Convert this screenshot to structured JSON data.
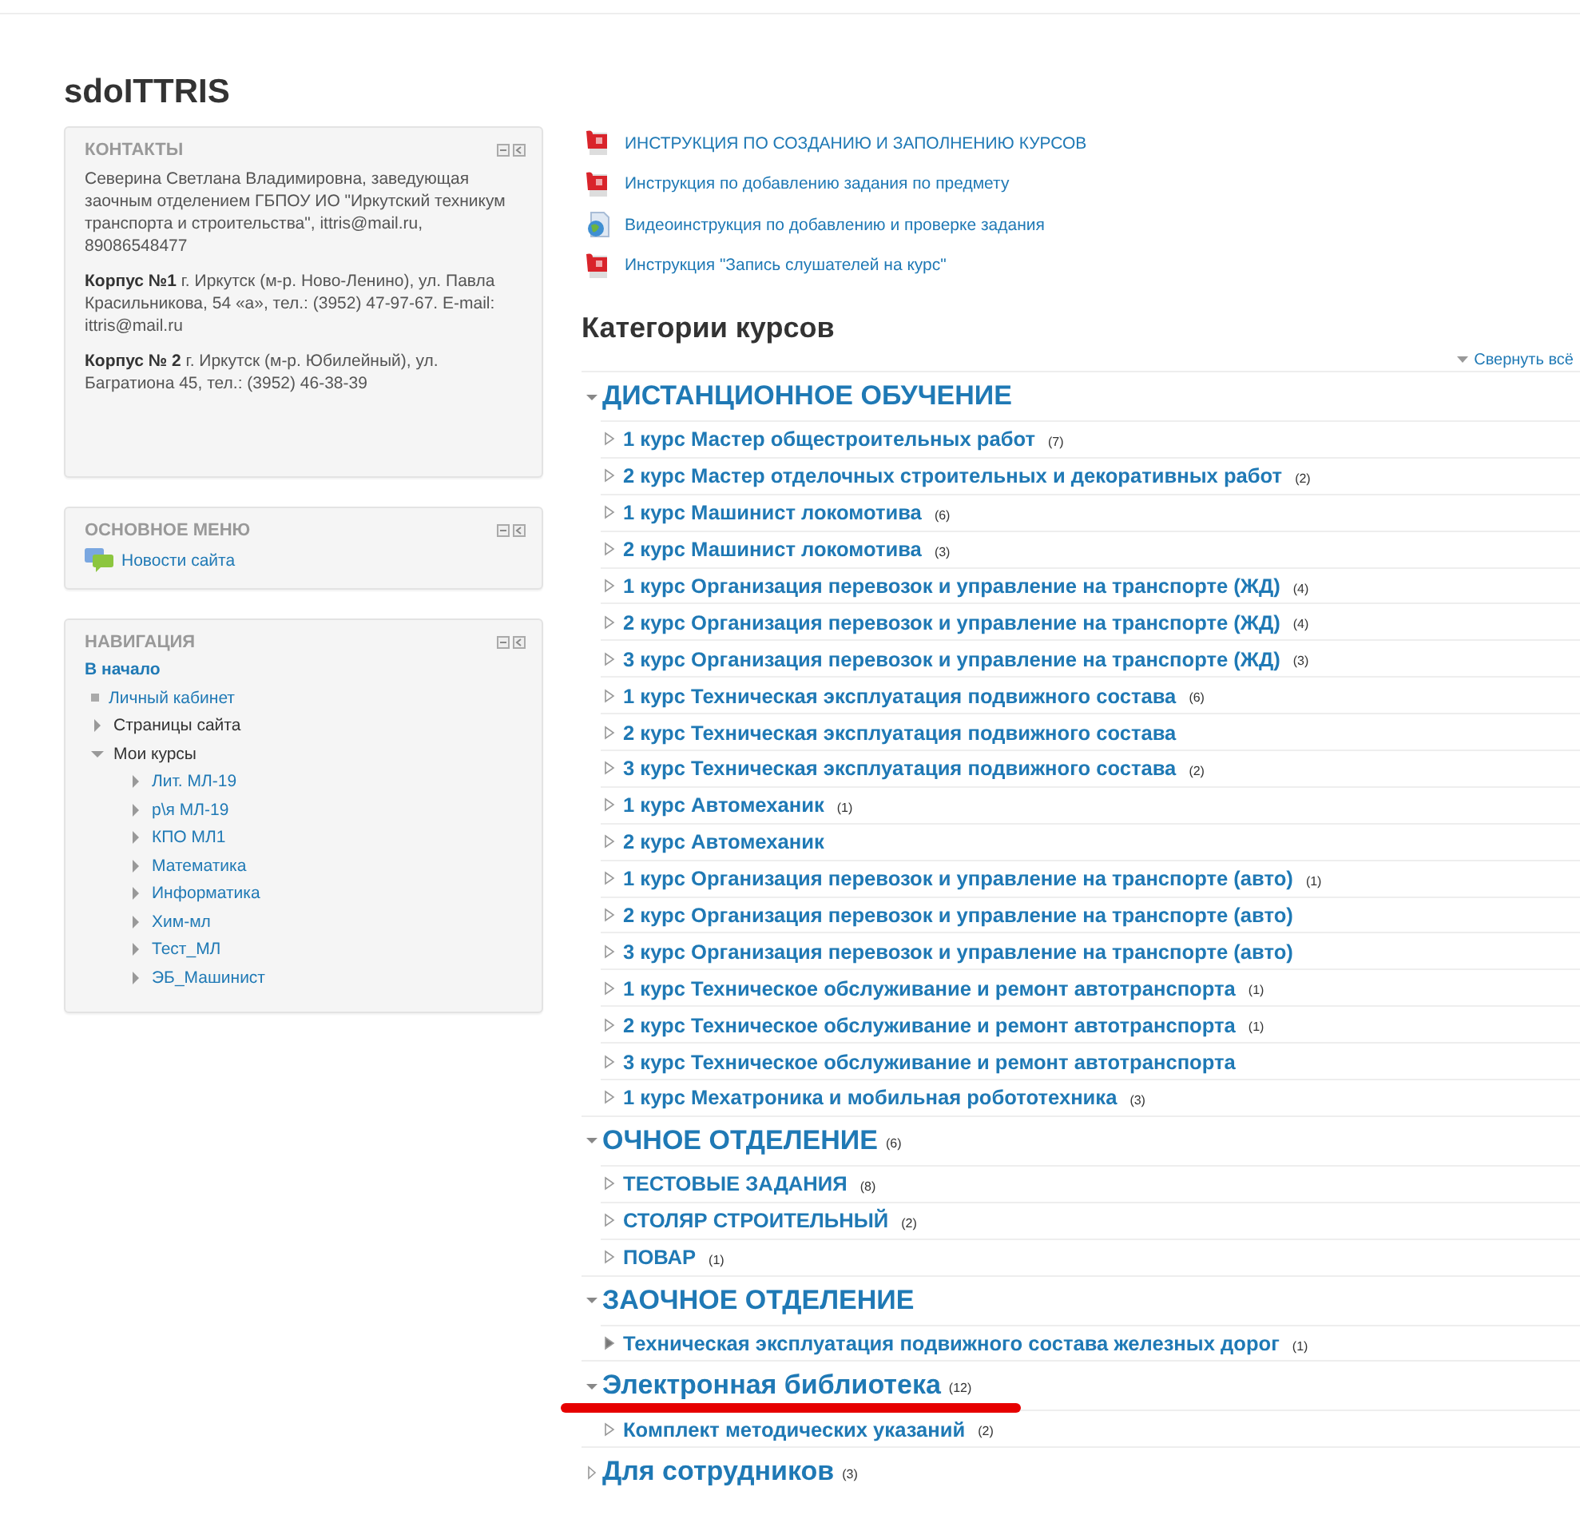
{
  "site_title": "sdoITTRIS",
  "contacts": {
    "title": "КОНТАКТЫ",
    "paragraphs": [
      "Северина Светлана Владимировна, заведующая заочным отделением ГБПОУ ИО \"Иркутский техникум транспорта и строительства\", ittris@mail.ru, 89086548477",
      "**Корпус №1** г. Иркутск (м-р. Ново-Ленино), ул. Павла Красильникова, 54 «а», тел.: (3952) 47-97-67. E-mail: ittris@mail.ru",
      "**Корпус № 2** г. Иркутск (м-р. Юбилейный), ул. Багратиона 45, тел.: (3952) 46-38-39"
    ]
  },
  "main_menu": {
    "title": "ОСНОВНОЕ МЕНЮ",
    "items": [
      "Новости сайта"
    ]
  },
  "navigation": {
    "title": "НАВИГАЦИЯ",
    "home": "В начало",
    "items": [
      {
        "label": "Личный кабинет",
        "kind": "leaf",
        "link": true
      },
      {
        "label": "Страницы сайта",
        "kind": "branch",
        "link": false,
        "expanded": false
      },
      {
        "label": "Мои курсы",
        "kind": "branch",
        "link": false,
        "expanded": true,
        "children": [
          {
            "label": "Лит. МЛ-19",
            "kind": "branch",
            "link": true,
            "expanded": false
          },
          {
            "label": "р\\я МЛ-19",
            "kind": "branch",
            "link": true,
            "expanded": false
          },
          {
            "label": "КПО МЛ1",
            "kind": "branch",
            "link": true,
            "expanded": false
          },
          {
            "label": "Математика",
            "kind": "branch",
            "link": true,
            "expanded": false
          },
          {
            "label": "Информатика",
            "kind": "branch",
            "link": true,
            "expanded": false
          },
          {
            "label": "Хим-мл",
            "kind": "branch",
            "link": true,
            "expanded": false
          },
          {
            "label": "Тест_МЛ",
            "kind": "branch",
            "link": true,
            "expanded": false
          },
          {
            "label": "ЭБ_Машинист",
            "kind": "branch",
            "link": true,
            "expanded": false
          }
        ]
      }
    ]
  },
  "resources": [
    {
      "label": "ИНСТРУКЦИЯ ПО СОЗДАНИЮ И ЗАПОЛНЕНИЮ КУРСОВ",
      "kind": "pdf"
    },
    {
      "label": "Инструкция по добавлению задания по предмету",
      "kind": "pdf"
    },
    {
      "label": "Видеоинструкция по добавлению и проверке задания",
      "kind": "web"
    },
    {
      "label": "Инструкция \"Запись слушателей на курс\"",
      "kind": "pdf"
    }
  ],
  "categories_heading": "Категории курсов",
  "collapse_all": "Свернуть всё",
  "categories": [
    {
      "name": "ДИСТАНЦИОННОЕ ОБУЧЕНИЕ",
      "expanded": true,
      "marked": false,
      "children": [
        {
          "name": "1 курс Мастер общестроительных работ",
          "count": "(7)",
          "kind": "hollow"
        },
        {
          "name": "2 курс Мастер отделочных строительных и декоративных работ",
          "count": "(2)",
          "kind": "hollow"
        },
        {
          "name": "1 курс Машинист локомотива",
          "count": "(6)",
          "kind": "hollow"
        },
        {
          "name": "2 курс Машинист локомотива",
          "count": "(3)",
          "kind": "hollow"
        },
        {
          "name": "1 курс Организация перевозок и управление на транспорте (ЖД)",
          "count": "(4)",
          "kind": "hollow"
        },
        {
          "name": "2 курс Организация перевозок и управление на транспорте (ЖД)",
          "count": "(4)",
          "kind": "hollow"
        },
        {
          "name": "3 курс Организация перевозок и управление на транспорте (ЖД)",
          "count": "(3)",
          "kind": "hollow"
        },
        {
          "name": "1 курс Техническая эксплуатация подвижного состава",
          "count": "(6)",
          "kind": "hollow"
        },
        {
          "name": "2 курс Техническая эксплуатация подвижного состава",
          "kind": "hollow"
        },
        {
          "name": "3 курс Техническая эксплуатация подвижного состава",
          "count": "(2)",
          "kind": "hollow"
        },
        {
          "name": "1 курс Автомеханик",
          "count": "(1)",
          "kind": "hollow"
        },
        {
          "name": "2 курс Автомеханик",
          "kind": "hollow"
        },
        {
          "name": "1 курс Организация перевозок и управление на транспорте (авто)",
          "count": "(1)",
          "kind": "hollow"
        },
        {
          "name": "2 курс Организация перевозок и управление на транспорте (авто)",
          "kind": "hollow"
        },
        {
          "name": "3 курс Организация перевозок и управление на транспорте (авто)",
          "kind": "hollow"
        },
        {
          "name": "1 курс Техническое обслуживание и ремонт автотранспорта",
          "count": "(1)",
          "kind": "hollow"
        },
        {
          "name": "2 курс Техническое обслуживание и ремонт автотранспорта",
          "count": "(1)",
          "kind": "hollow"
        },
        {
          "name": "3 курс Техническое обслуживание и ремонт автотранспорта",
          "kind": "hollow"
        },
        {
          "name": "1 курс Мехатроника и мобильная робототехника",
          "count": "(3)",
          "kind": "hollow"
        }
      ]
    },
    {
      "name": "ОЧНОЕ ОТДЕЛЕНИЕ",
      "count": "(6)",
      "expanded": true,
      "marked": false,
      "children": [
        {
          "name": "ТЕСТОВЫЕ ЗАДАНИЯ",
          "count": "(8)",
          "kind": "hollow"
        },
        {
          "name": "СТОЛЯР СТРОИТЕЛЬНЫЙ",
          "count": "(2)",
          "kind": "hollow"
        },
        {
          "name": "ПОВАР",
          "count": "(1)",
          "kind": "hollow"
        }
      ]
    },
    {
      "name": "ЗАОЧНОЕ ОТДЕЛЕНИЕ",
      "expanded": true,
      "marked": false,
      "children": [
        {
          "name": "Техническая эксплуатация подвижного состава железных дорог",
          "count": "(1)",
          "kind": "filled"
        }
      ]
    },
    {
      "name": "Электронная библиотека",
      "count": "(12)",
      "expanded": true,
      "marked": true,
      "children": [
        {
          "name": "Комплект методических указаний",
          "count": "(2)",
          "kind": "hollow"
        }
      ]
    },
    {
      "name": "Для сотрудников",
      "count": "(3)",
      "expanded": false,
      "marked": false
    }
  ]
}
